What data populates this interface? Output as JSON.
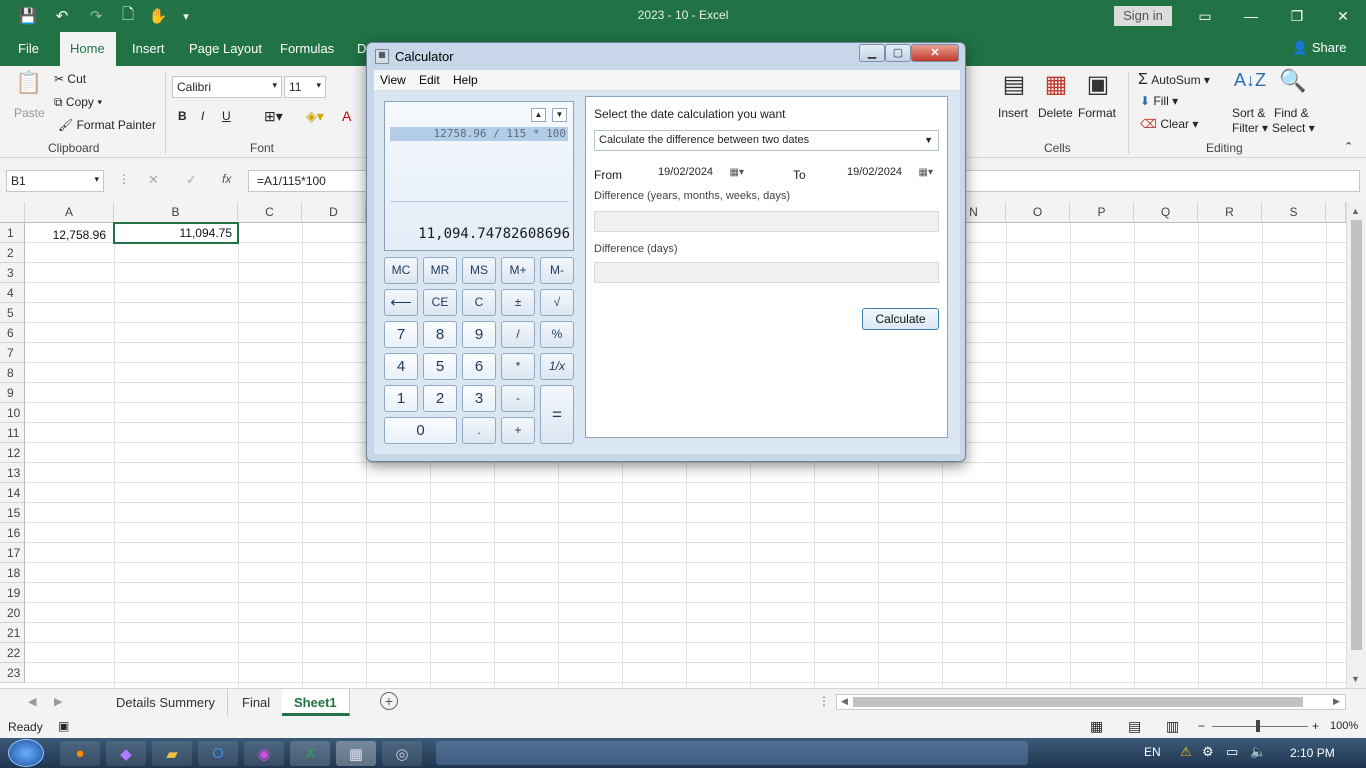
{
  "window": {
    "title": "2023 - 10  -  Excel",
    "sign_in": "Sign in"
  },
  "ribbon_tabs": [
    "File",
    "Home",
    "Insert",
    "Page Layout",
    "Formulas",
    "D"
  ],
  "share_label": "Share",
  "clipboard": {
    "paste": "Paste",
    "cut": "Cut",
    "copy": "Copy",
    "format_painter": "Format Painter",
    "label": "Clipboard"
  },
  "font": {
    "name": "Calibri",
    "size": "11",
    "label": "Font",
    "bold": "B",
    "italic": "I",
    "underline": "U"
  },
  "cells_group": {
    "insert": "Insert",
    "delete": "Delete",
    "format": "Format",
    "label": "Cells"
  },
  "editing": {
    "autosum": "AutoSum",
    "fill": "Fill",
    "clear": "Clear",
    "sort_filter_1": "Sort &",
    "sort_filter_2": "Filter",
    "find_select_1": "Find &",
    "find_select_2": "Select",
    "label": "Editing"
  },
  "formula_bar": {
    "name_box": "B1",
    "formula": "=A1/115*100",
    "fx": "fx"
  },
  "columns": [
    "A",
    "B",
    "C",
    "D",
    "N",
    "O",
    "P",
    "Q",
    "R",
    "S"
  ],
  "rows": [
    "1",
    "2",
    "3",
    "4",
    "5",
    "6",
    "7",
    "8",
    "9",
    "10",
    "11",
    "12",
    "13",
    "14",
    "15",
    "16",
    "17",
    "18",
    "19",
    "20",
    "21",
    "22",
    "23"
  ],
  "cells": {
    "A1": "12,758.96",
    "B1": "11,094.75"
  },
  "sheet_tabs": [
    "Details Summery",
    "Final",
    "Sheet1"
  ],
  "status": {
    "ready": "Ready",
    "zoom": "100%"
  },
  "taskbar": {
    "lang": "EN",
    "time": "2:10 PM"
  },
  "calculator": {
    "title": "Calculator",
    "menu": [
      "View",
      "Edit",
      "Help"
    ],
    "history": "12758.96 / 115 * 100",
    "result": "11,094.74782608696",
    "memory_row": [
      "MC",
      "MR",
      "MS",
      "M+",
      "M-"
    ],
    "row2": [
      "⟵",
      "CE",
      "C",
      "±",
      "√"
    ],
    "row3": [
      "7",
      "8",
      "9",
      "/",
      "%"
    ],
    "row4": [
      "4",
      "5",
      "6",
      "*",
      "1/x"
    ],
    "row5": [
      "1",
      "2",
      "3",
      "-"
    ],
    "row6": [
      "0",
      ".",
      "+"
    ],
    "equals": "=",
    "date": {
      "prompt": "Select the date calculation you want",
      "mode": "Calculate the difference between two dates",
      "from_label": "From",
      "from_value": "19/02/2024",
      "to_label": "To",
      "to_value": "19/02/2024",
      "diff_ymwd_label": "Difference (years, months, weeks, days)",
      "diff_days_label": "Difference (days)",
      "calculate": "Calculate"
    }
  }
}
